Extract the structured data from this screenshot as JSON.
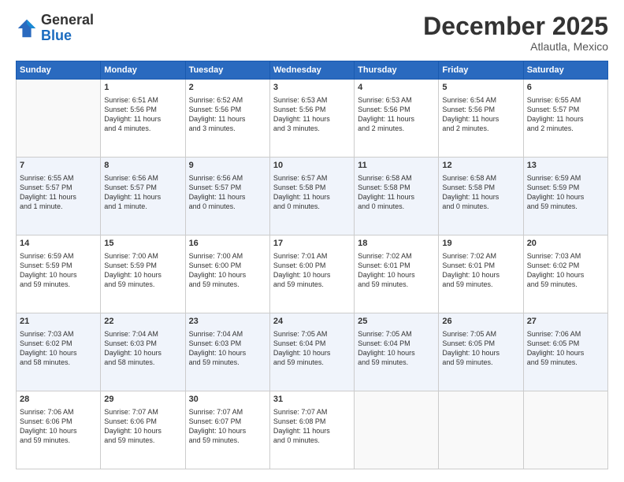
{
  "header": {
    "logo_general": "General",
    "logo_blue": "Blue",
    "month": "December 2025",
    "location": "Atlautla, Mexico"
  },
  "weekdays": [
    "Sunday",
    "Monday",
    "Tuesday",
    "Wednesday",
    "Thursday",
    "Friday",
    "Saturday"
  ],
  "weeks": [
    [
      {
        "day": "",
        "info": ""
      },
      {
        "day": "1",
        "info": "Sunrise: 6:51 AM\nSunset: 5:56 PM\nDaylight: 11 hours\nand 4 minutes."
      },
      {
        "day": "2",
        "info": "Sunrise: 6:52 AM\nSunset: 5:56 PM\nDaylight: 11 hours\nand 3 minutes."
      },
      {
        "day": "3",
        "info": "Sunrise: 6:53 AM\nSunset: 5:56 PM\nDaylight: 11 hours\nand 3 minutes."
      },
      {
        "day": "4",
        "info": "Sunrise: 6:53 AM\nSunset: 5:56 PM\nDaylight: 11 hours\nand 2 minutes."
      },
      {
        "day": "5",
        "info": "Sunrise: 6:54 AM\nSunset: 5:56 PM\nDaylight: 11 hours\nand 2 minutes."
      },
      {
        "day": "6",
        "info": "Sunrise: 6:55 AM\nSunset: 5:57 PM\nDaylight: 11 hours\nand 2 minutes."
      }
    ],
    [
      {
        "day": "7",
        "info": "Sunrise: 6:55 AM\nSunset: 5:57 PM\nDaylight: 11 hours\nand 1 minute."
      },
      {
        "day": "8",
        "info": "Sunrise: 6:56 AM\nSunset: 5:57 PM\nDaylight: 11 hours\nand 1 minute."
      },
      {
        "day": "9",
        "info": "Sunrise: 6:56 AM\nSunset: 5:57 PM\nDaylight: 11 hours\nand 0 minutes."
      },
      {
        "day": "10",
        "info": "Sunrise: 6:57 AM\nSunset: 5:58 PM\nDaylight: 11 hours\nand 0 minutes."
      },
      {
        "day": "11",
        "info": "Sunrise: 6:58 AM\nSunset: 5:58 PM\nDaylight: 11 hours\nand 0 minutes."
      },
      {
        "day": "12",
        "info": "Sunrise: 6:58 AM\nSunset: 5:58 PM\nDaylight: 11 hours\nand 0 minutes."
      },
      {
        "day": "13",
        "info": "Sunrise: 6:59 AM\nSunset: 5:59 PM\nDaylight: 10 hours\nand 59 minutes."
      }
    ],
    [
      {
        "day": "14",
        "info": "Sunrise: 6:59 AM\nSunset: 5:59 PM\nDaylight: 10 hours\nand 59 minutes."
      },
      {
        "day": "15",
        "info": "Sunrise: 7:00 AM\nSunset: 5:59 PM\nDaylight: 10 hours\nand 59 minutes."
      },
      {
        "day": "16",
        "info": "Sunrise: 7:00 AM\nSunset: 6:00 PM\nDaylight: 10 hours\nand 59 minutes."
      },
      {
        "day": "17",
        "info": "Sunrise: 7:01 AM\nSunset: 6:00 PM\nDaylight: 10 hours\nand 59 minutes."
      },
      {
        "day": "18",
        "info": "Sunrise: 7:02 AM\nSunset: 6:01 PM\nDaylight: 10 hours\nand 59 minutes."
      },
      {
        "day": "19",
        "info": "Sunrise: 7:02 AM\nSunset: 6:01 PM\nDaylight: 10 hours\nand 59 minutes."
      },
      {
        "day": "20",
        "info": "Sunrise: 7:03 AM\nSunset: 6:02 PM\nDaylight: 10 hours\nand 59 minutes."
      }
    ],
    [
      {
        "day": "21",
        "info": "Sunrise: 7:03 AM\nSunset: 6:02 PM\nDaylight: 10 hours\nand 58 minutes."
      },
      {
        "day": "22",
        "info": "Sunrise: 7:04 AM\nSunset: 6:03 PM\nDaylight: 10 hours\nand 58 minutes."
      },
      {
        "day": "23",
        "info": "Sunrise: 7:04 AM\nSunset: 6:03 PM\nDaylight: 10 hours\nand 59 minutes."
      },
      {
        "day": "24",
        "info": "Sunrise: 7:05 AM\nSunset: 6:04 PM\nDaylight: 10 hours\nand 59 minutes."
      },
      {
        "day": "25",
        "info": "Sunrise: 7:05 AM\nSunset: 6:04 PM\nDaylight: 10 hours\nand 59 minutes."
      },
      {
        "day": "26",
        "info": "Sunrise: 7:05 AM\nSunset: 6:05 PM\nDaylight: 10 hours\nand 59 minutes."
      },
      {
        "day": "27",
        "info": "Sunrise: 7:06 AM\nSunset: 6:05 PM\nDaylight: 10 hours\nand 59 minutes."
      }
    ],
    [
      {
        "day": "28",
        "info": "Sunrise: 7:06 AM\nSunset: 6:06 PM\nDaylight: 10 hours\nand 59 minutes."
      },
      {
        "day": "29",
        "info": "Sunrise: 7:07 AM\nSunset: 6:06 PM\nDaylight: 10 hours\nand 59 minutes."
      },
      {
        "day": "30",
        "info": "Sunrise: 7:07 AM\nSunset: 6:07 PM\nDaylight: 10 hours\nand 59 minutes."
      },
      {
        "day": "31",
        "info": "Sunrise: 7:07 AM\nSunset: 6:08 PM\nDaylight: 11 hours\nand 0 minutes."
      },
      {
        "day": "",
        "info": ""
      },
      {
        "day": "",
        "info": ""
      },
      {
        "day": "",
        "info": ""
      }
    ]
  ]
}
